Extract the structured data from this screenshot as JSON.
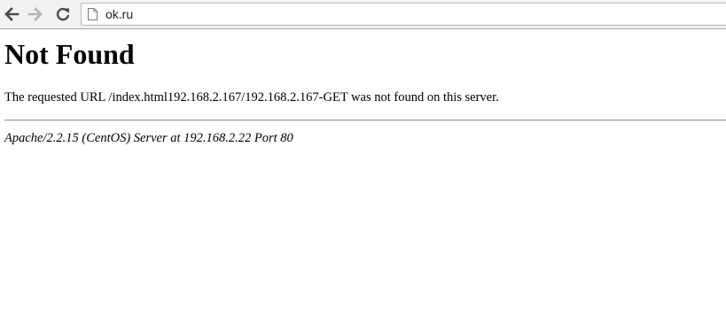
{
  "browser": {
    "url": "ok.ru",
    "icons": {
      "back": "arrow-left-icon",
      "forward": "arrow-right-icon",
      "reload": "reload-icon",
      "page": "page-icon"
    }
  },
  "page": {
    "title": "Not Found",
    "message": "The requested URL /index.html192.168.2.167/192.168.2.167-GET was not found on this server.",
    "signature": "Apache/2.2.15 (CentOS) Server at 192.168.2.22 Port 80"
  }
}
